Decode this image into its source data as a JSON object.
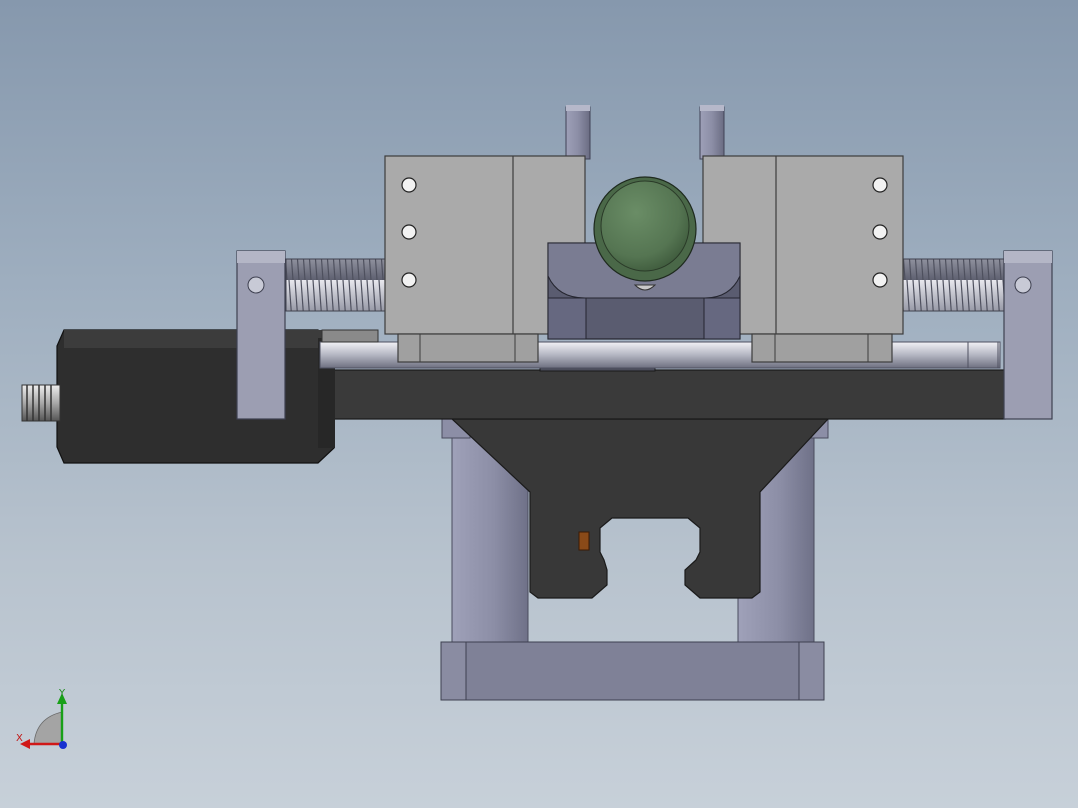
{
  "viewport": {
    "background_top": "#8698ad",
    "background_bottom": "#c7d0d9"
  },
  "triad": {
    "x_label": "X",
    "y_label": "Y",
    "x_color": "#d01818",
    "y_color": "#18a018",
    "z_color": "#1830d0"
  },
  "model": {
    "parts": [
      "motor",
      "motor-shaft",
      "end-bracket-left",
      "end-bracket-right",
      "ball-screw-left",
      "ball-screw-right",
      "guide-rod",
      "jaw-block-left",
      "jaw-block-right",
      "v-block",
      "workpiece-cylinder",
      "locating-pins",
      "base-plate",
      "hopper-mount",
      "linear-rail-carriage",
      "support-columns",
      "bottom-plate"
    ],
    "colors": {
      "dark_body": "#3a3a3a",
      "jaw_gray": "#a9a9a9",
      "v_block": "#6c6e84",
      "workpiece": "#5a7a56",
      "column": "#8e90a8",
      "bracket": "#9a9cae"
    }
  }
}
